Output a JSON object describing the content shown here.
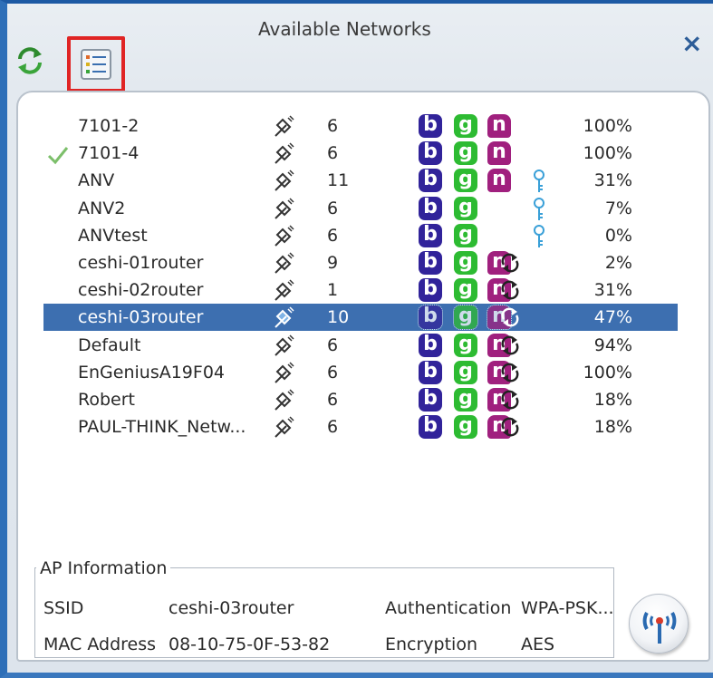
{
  "window": {
    "title": "Available Networks",
    "close_glyph": "×"
  },
  "toolbar": {
    "refresh_icon": "refresh-icon",
    "list_icon": "list-view-icon"
  },
  "networks": [
    {
      "ssid": "7101-2",
      "channel": "6",
      "signal": "100%",
      "modes": [
        "b",
        "g",
        "n"
      ],
      "security": "",
      "connected": false
    },
    {
      "ssid": "7101-4",
      "channel": "6",
      "signal": "100%",
      "modes": [
        "b",
        "g",
        "n"
      ],
      "security": "",
      "connected": true
    },
    {
      "ssid": "ANV",
      "channel": "11",
      "signal": "31%",
      "modes": [
        "b",
        "g",
        "n"
      ],
      "security": "key",
      "connected": false
    },
    {
      "ssid": "ANV2",
      "channel": "6",
      "signal": "7%",
      "modes": [
        "b",
        "g"
      ],
      "security": "key",
      "connected": false
    },
    {
      "ssid": "ANVtest",
      "channel": "6",
      "signal": "0%",
      "modes": [
        "b",
        "g"
      ],
      "security": "key",
      "connected": false
    },
    {
      "ssid": "ceshi-01router",
      "channel": "9",
      "signal": "2%",
      "modes": [
        "b",
        "g",
        "n"
      ],
      "security": "wps",
      "connected": false
    },
    {
      "ssid": "ceshi-02router",
      "channel": "1",
      "signal": "31%",
      "modes": [
        "b",
        "g",
        "n"
      ],
      "security": "wps",
      "connected": false
    },
    {
      "ssid": "ceshi-03router",
      "channel": "10",
      "signal": "47%",
      "modes": [
        "b",
        "g",
        "n"
      ],
      "security": "wps",
      "connected": false
    },
    {
      "ssid": "Default",
      "channel": "6",
      "signal": "94%",
      "modes": [
        "b",
        "g",
        "n"
      ],
      "security": "wps",
      "connected": false
    },
    {
      "ssid": "EnGeniusA19F04",
      "channel": "6",
      "signal": "100%",
      "modes": [
        "b",
        "g",
        "n"
      ],
      "security": "wps",
      "connected": false
    },
    {
      "ssid": "Robert",
      "channel": "6",
      "signal": "18%",
      "modes": [
        "b",
        "g",
        "n"
      ],
      "security": "wps",
      "connected": false
    },
    {
      "ssid": "PAUL-THINK_Netw...",
      "channel": "6",
      "signal": "18%",
      "modes": [
        "b",
        "g",
        "n"
      ],
      "security": "wps",
      "connected": false
    }
  ],
  "selected_index": 7,
  "ap_info": {
    "legend": "AP Information",
    "ssid_label": "SSID",
    "ssid_value": "ceshi-03router",
    "auth_label": "Authentication",
    "auth_value": "WPA-PSK...",
    "mac_label": "MAC Address",
    "mac_value": "08-10-75-0F-53-82",
    "enc_label": "Encryption",
    "enc_value": "AES"
  },
  "colors": {
    "selection": "#3d6fb0",
    "mode_b": "#31239a",
    "mode_g": "#2dbb32",
    "mode_n": "#a0207e",
    "highlight_border": "#e02424"
  }
}
